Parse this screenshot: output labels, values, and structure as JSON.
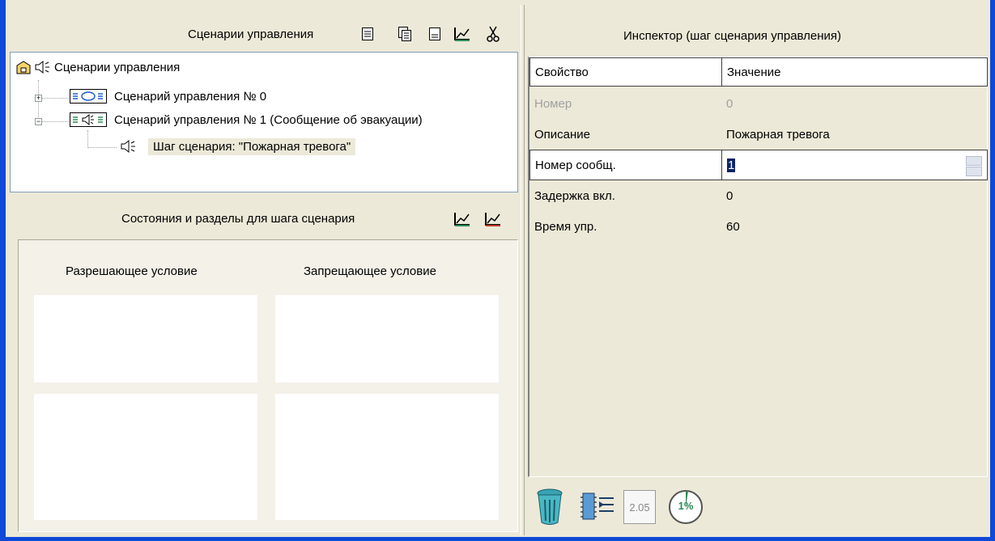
{
  "scenarios_panel": {
    "title": "Сценарии управления",
    "tree": {
      "root_label": "Сценарии управления",
      "items": [
        {
          "label": "Сценарий управления № 0",
          "expanded": false
        },
        {
          "label": "Сценарий управления № 1 (Сообщение об эвакуации)",
          "expanded": true,
          "children": [
            {
              "label": "Шаг сценария: \"Пожарная тревога\""
            }
          ]
        }
      ]
    },
    "toolbar_icons": [
      "new-document-icon",
      "copy-document-icon",
      "blank-document-icon",
      "edit-chart-icon",
      "cut-scissors-icon"
    ]
  },
  "conditions_panel": {
    "title": "Состояния и разделы для шага сценария",
    "allow_label": "Разрешающее условие",
    "deny_label": "Запрещающее условие",
    "toolbar_icons": [
      "edit-allow-icon",
      "edit-deny-icon"
    ]
  },
  "inspector": {
    "title": "Инспектор (шаг сценария управления)",
    "columns": [
      "Свойство",
      "Значение"
    ],
    "rows": [
      {
        "name": "Номер",
        "value": "0",
        "disabled": true
      },
      {
        "name": "Описание",
        "value": "Пожарная тревога"
      },
      {
        "name": "Номер сообщ.",
        "value": "1",
        "editing": true
      },
      {
        "name": "Задержка вкл.",
        "value": "0"
      },
      {
        "name": "Время упр.",
        "value": "60"
      }
    ]
  },
  "bottom_toolbar": {
    "version_label": "2.05",
    "progress_label": "1%",
    "icons": [
      "trash-icon",
      "chip-list-icon",
      "version-document-icon",
      "progress-gauge-icon"
    ]
  },
  "colors": {
    "window_border": "#0f49d8",
    "panel_bg": "#ece9d8",
    "selection": "#0a246a",
    "icon_green": "#2e8b57"
  }
}
